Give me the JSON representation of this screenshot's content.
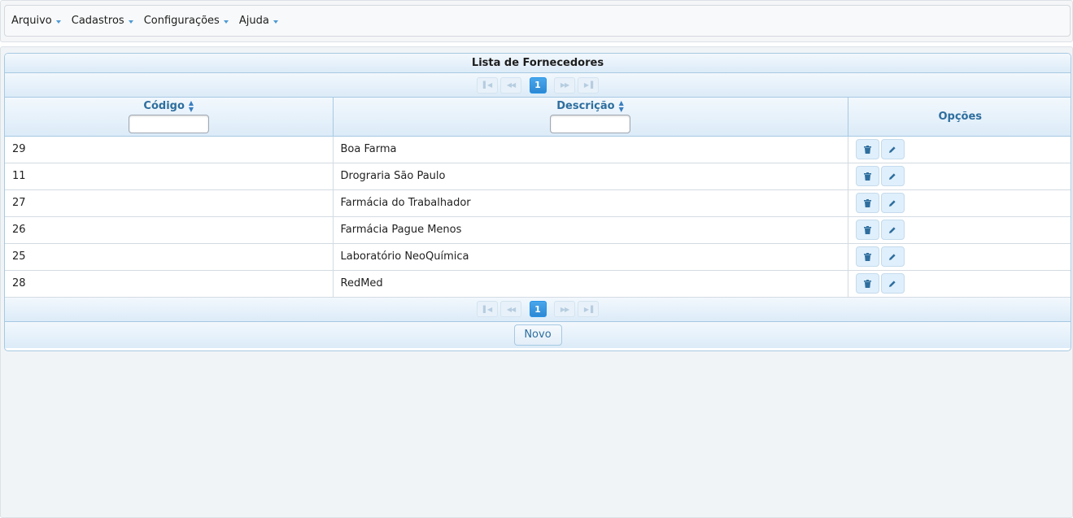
{
  "menu": [
    {
      "label": "Arquivo"
    },
    {
      "label": "Cadastros"
    },
    {
      "label": "Configurações"
    },
    {
      "label": "Ajuda"
    }
  ],
  "panel": {
    "title": "Lista de Fornecedores",
    "current_page": "1",
    "columns": {
      "codigo": "Código",
      "descricao": "Descrição",
      "opcoes": "Opções"
    },
    "rows": [
      {
        "codigo": "29",
        "descricao": "Boa Farma"
      },
      {
        "codigo": "11",
        "descricao": "Drograria São Paulo"
      },
      {
        "codigo": "27",
        "descricao": "Farmácia do Trabalhador"
      },
      {
        "codigo": "26",
        "descricao": "Farmácia Pague Menos"
      },
      {
        "codigo": "25",
        "descricao": "Laboratório NeoQuímica"
      },
      {
        "codigo": "28",
        "descricao": "RedMed"
      }
    ],
    "novo_label": "Novo"
  },
  "icons": {
    "pager_first": "first-page-icon",
    "pager_prev": "prev-page-icon",
    "pager_next": "next-page-icon",
    "pager_last": "last-page-icon",
    "row_delete": "trash-icon",
    "row_edit": "pencil-icon",
    "sort": "sort-icon"
  },
  "colors": {
    "accent": "#2e6e9e",
    "active_page": "#2d88d4",
    "border": "#a6c9e2"
  }
}
